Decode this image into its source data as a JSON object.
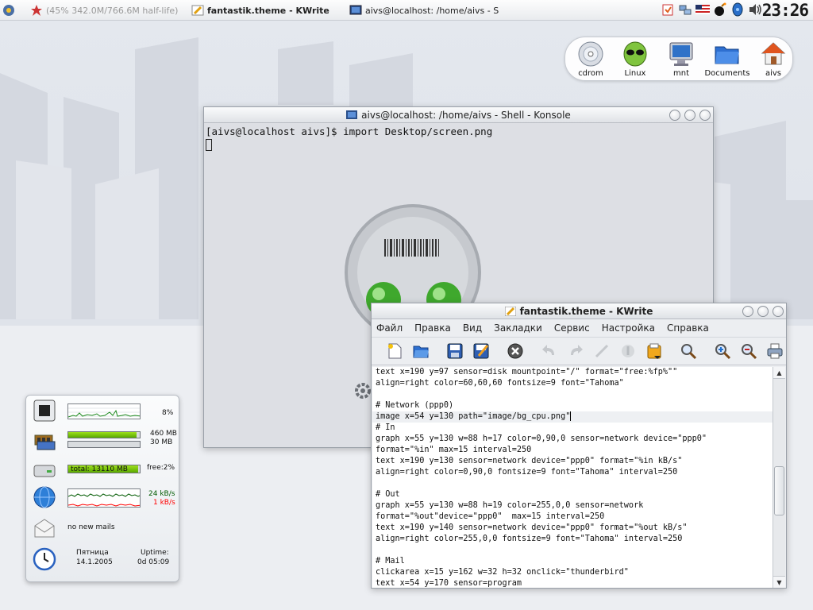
{
  "taskbar": {
    "items": [
      {
        "label": "(45% 342.0M/766.6M half-life)",
        "icon": "cpu-monitor-icon"
      },
      {
        "label": "fantastik.theme - KWrite",
        "icon": "pen-icon"
      },
      {
        "label": "aivs@localhost: /home/aivs - S",
        "icon": "terminal-icon"
      }
    ],
    "clock": "23:26"
  },
  "dock": {
    "items": [
      {
        "label": "cdrom",
        "icon": "cdrom-icon"
      },
      {
        "label": "Linux",
        "icon": "alien-icon"
      },
      {
        "label": "mnt",
        "icon": "monitor-icon"
      },
      {
        "label": "Documents",
        "icon": "folder-icon"
      },
      {
        "label": "aivs",
        "icon": "home-icon"
      }
    ]
  },
  "konsole": {
    "title": "aivs@localhost: /home/aivs - Shell - Konsole",
    "prompt_line": "[aivs@localhost aivs]$ import Desktop/screen.png"
  },
  "kwrite": {
    "title": "fantastik.theme - KWrite",
    "menu": [
      "Файл",
      "Правка",
      "Вид",
      "Закладки",
      "Сервис",
      "Настройка",
      "Справка"
    ],
    "toolbar": [
      "new-icon",
      "open-icon",
      "save-icon",
      "save-as-icon",
      "close-icon",
      "undo-icon",
      "redo-icon",
      "cut-icon",
      "copy-icon",
      "paste-icon",
      "find-icon",
      "zoom-in-icon",
      "zoom-out-icon",
      "print-icon"
    ],
    "lines": [
      "text x=190 y=97 sensor=disk mountpoint=\"/\" format=\"free:%fp%\"\"",
      "align=right color=60,60,60 fontsize=9 font=\"Tahoma\"",
      "",
      "# Network (ppp0)",
      "image x=54 y=130 path=\"image/bg_cpu.png\"",
      "# In",
      "graph x=55 y=130 w=88 h=17 color=0,90,0 sensor=network device=\"ppp0\"",
      "format=\"%in\" max=15 interval=250",
      "text x=190 y=130 sensor=network device=\"ppp0\" format=\"%in kB/s\"",
      "align=right color=0,90,0 fontsize=9 font=\"Tahoma\" interval=250",
      "",
      "# Out",
      "graph x=55 y=130 w=88 h=19 color=255,0,0 sensor=network",
      "format=\"%out\"device=\"ppp0\"  max=15 interval=250",
      "text x=190 y=140 sensor=network device=\"ppp0\" format=\"%out kB/s\"",
      "align=right color=255,0,0 fontsize=9 font=\"Tahoma\" interval=250",
      "",
      "# Mail",
      "clickarea x=15 y=162 w=32 h=32 onclick=\"thunderbird\"",
      "text x=54 y=170 sensor=program"
    ],
    "current_line": 4
  },
  "karamba": {
    "cpu": {
      "value": "8%"
    },
    "memory": {
      "ram": "460 MB",
      "swap": "30 MB",
      "ram_fill": 0.96,
      "swap_fill": 0.0
    },
    "disk": {
      "total": "total: 13110 MB",
      "free": "free:2%",
      "fill": 0.98
    },
    "network": {
      "in": "24 kB/s",
      "out": "1 kB/s",
      "colors": {
        "in": "#005a00",
        "out": "#ff0000"
      }
    },
    "mail": {
      "status": "no new mails"
    },
    "date": {
      "day": "Пятница",
      "date": "14.1.2005",
      "uptime_label": "Uptime:",
      "uptime": "0d 05:09"
    }
  }
}
